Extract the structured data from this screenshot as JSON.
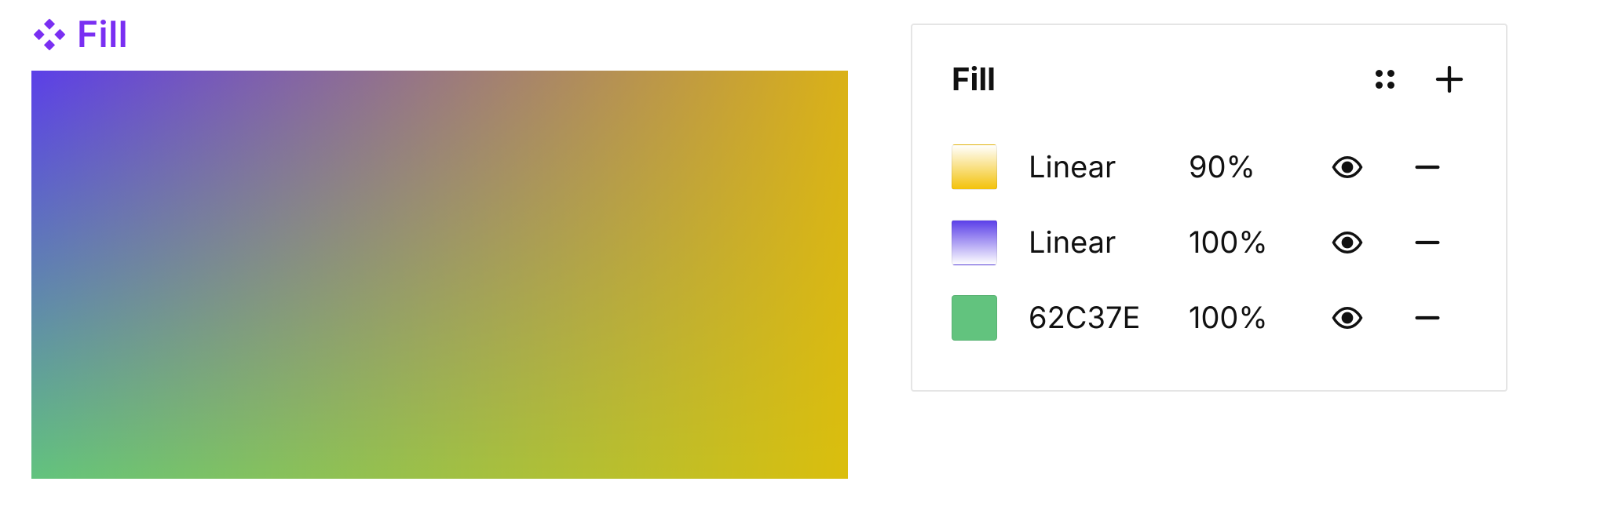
{
  "preview": {
    "label": "Fill"
  },
  "panel": {
    "title": "Fill",
    "fills": [
      {
        "name": "Linear",
        "opacity": "90%"
      },
      {
        "name": "Linear",
        "opacity": "100%"
      },
      {
        "name": "62C37E",
        "opacity": "100%"
      }
    ]
  },
  "colors": {
    "accent_purple": "#7A2FF2",
    "grad_purple": "#5B3FE8",
    "grad_yellow": "#E8BE00",
    "solid_green": "#62C37E"
  }
}
